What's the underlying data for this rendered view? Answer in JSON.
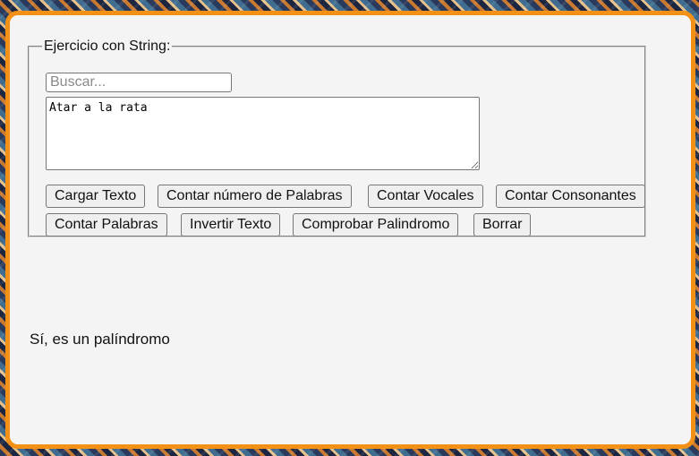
{
  "fieldset": {
    "legend": "Ejercicio con String:"
  },
  "search": {
    "placeholder": "Buscar...",
    "value": ""
  },
  "textarea": {
    "value": "Atar a la rata"
  },
  "buttons": {
    "cargar_texto": "Cargar Texto",
    "contar_numero_palabras": "Contar número de Palabras",
    "contar_vocales": "Contar Vocales",
    "contar_consonantes": "Contar Consonantes",
    "contar_palabras": "Contar Palabras",
    "invertir_texto": "Invertir Texto",
    "comprobar_palindromo": "Comprobar Palindromo",
    "borrar": "Borrar"
  },
  "result": {
    "text": "Sí, es un palíndromo"
  },
  "colors": {
    "frame_border": "#f39016",
    "panel_background": "#f4f4f4"
  }
}
